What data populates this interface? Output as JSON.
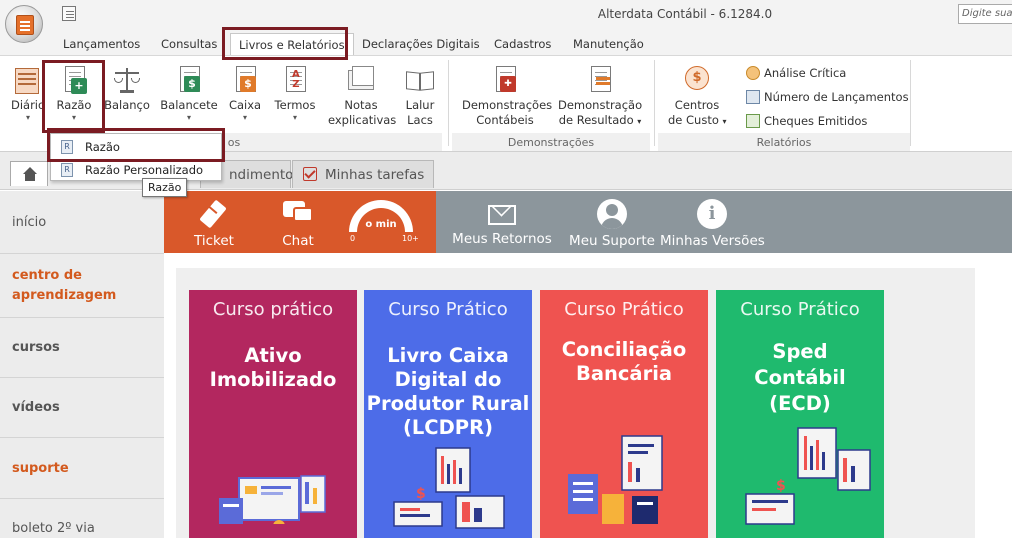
{
  "window": {
    "title": "Alterdata Contábil - 6.1284.0",
    "search_placeholder": "Digite sua"
  },
  "menu_tabs": [
    {
      "label": "Lançamentos"
    },
    {
      "label": "Consultas"
    },
    {
      "label": "Livros e Relatórios",
      "active": true
    },
    {
      "label": "Declarações Digitais"
    },
    {
      "label": "Cadastros"
    },
    {
      "label": "Manutenção"
    }
  ],
  "ribbon": {
    "books_buttons": [
      {
        "line1": "Diário",
        "caret": "▾",
        "icon": "diario-book-icon"
      },
      {
        "line1": "Razão",
        "caret": "▾",
        "icon": "razao-ledger-icon"
      },
      {
        "line1": "Balanço",
        "caret": "",
        "icon": "balance-scale-icon"
      },
      {
        "line1": "Balancete",
        "caret": "▾",
        "icon": "balancete-doc-icon"
      },
      {
        "line1": "Caixa",
        "caret": "▾",
        "icon": "cash-book-icon"
      },
      {
        "line1": "Termos",
        "caret": "▾",
        "icon": "terms-az-icon"
      },
      {
        "line1": "Notas",
        "line2": "explicativas",
        "icon": "notes-icon"
      },
      {
        "line1": "Lalur",
        "line2": "Lacs",
        "icon": "open-book-icon"
      }
    ],
    "books_group_label": "os",
    "demo_buttons": [
      {
        "line1": "Demonstrações",
        "line2": "Contábeis",
        "icon": "demonstrations-icon"
      },
      {
        "line1": "Demonstração",
        "line2": "de Resultado",
        "caret": "▾",
        "icon": "result-statement-icon"
      }
    ],
    "demo_group_label": "Demonstrações",
    "reports_button": {
      "line1": "Centros",
      "line2": "de Custo",
      "caret": "▾",
      "icon": "cost-center-icon"
    },
    "reports_items": [
      {
        "label": "Análise Crítica",
        "icon": "critical-analysis-icon"
      },
      {
        "label": "Número de Lançamentos",
        "icon": "entries-count-icon"
      },
      {
        "label": "Cheques Emitidos",
        "icon": "cheques-icon"
      }
    ],
    "reports_group_label": "Relatórios"
  },
  "dropdown": {
    "items": [
      {
        "label": "Razão"
      },
      {
        "label": "Razão Personalizado"
      }
    ],
    "tooltip": "Razão"
  },
  "doc_tabs": {
    "partial_tab": "ndimentos",
    "tasks_tab": "Minhas tarefas"
  },
  "sidebar": [
    {
      "label": "início"
    },
    {
      "label": "centro de aprendizagem"
    },
    {
      "label": "cursos"
    },
    {
      "label": "vídeos"
    },
    {
      "label": "suporte"
    },
    {
      "label": "boleto 2º via"
    }
  ],
  "banner": {
    "ticket": "Ticket",
    "chat": "Chat",
    "gauge_center": "o min",
    "gauge_min": "0",
    "gauge_max": "10+",
    "returns": "Meus Retornos",
    "support": "Meu Suporte",
    "versions": "Minhas Versões",
    "orange_color": "#d9582a",
    "gray_color": "#8c969c"
  },
  "courses": [
    {
      "kicker": "Curso prático",
      "title_lines": [
        "Ativo",
        "Imobilizado"
      ],
      "color": "#b3275f"
    },
    {
      "kicker": "Curso Prático",
      "title_lines": [
        "Livro Caixa",
        "Digital do",
        "Produtor Rural",
        "(LCDPR)"
      ],
      "color": "#4d6ce8"
    },
    {
      "kicker": "Curso Prático",
      "title_lines": [
        "Conciliação",
        "Bancária"
      ],
      "color": "#ef5350"
    },
    {
      "kicker": "Curso Prático",
      "title_lines": [
        "Sped",
        "Contábil",
        "(ECD)"
      ],
      "color": "#1fba6e"
    }
  ]
}
